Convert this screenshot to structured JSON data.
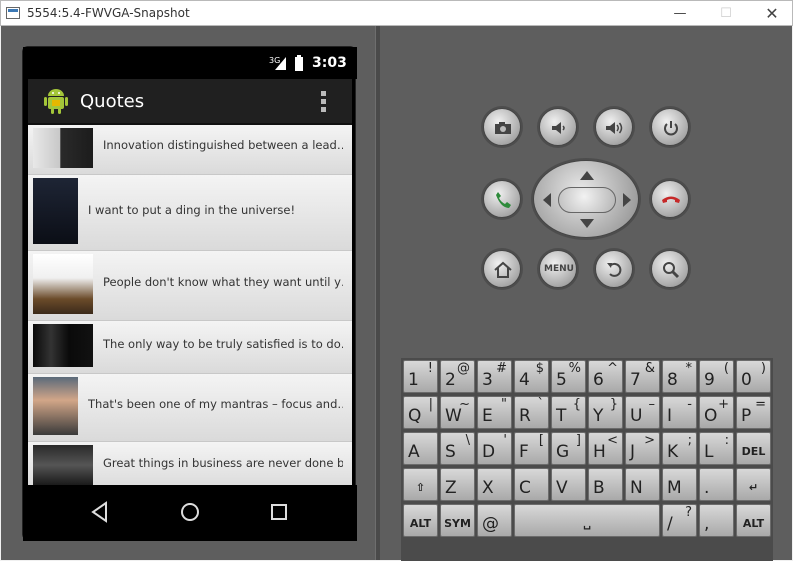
{
  "window": {
    "title": "5554:5.4-FWVGA-Snapshot",
    "minimize_glyph": "—",
    "maximize_glyph": "☐",
    "close_glyph": "✕"
  },
  "phone": {
    "status": {
      "network": "3G",
      "time": "3:03"
    },
    "app": {
      "title": "Quotes",
      "accent": "#a4c639"
    },
    "quotes": [
      "Innovation distinguished between a lead…",
      "I want to put a ding in the universe!",
      "People don't know what they want until y…",
      "The only way to be truly satisfied is to do…",
      "That's been one of my mantras – focus and…",
      "Great things in business are never done b…"
    ]
  },
  "controls": {
    "menu_label": "MENU",
    "icons": [
      "camera-icon",
      "volume-down-icon",
      "volume-up-icon",
      "power-icon",
      "call-icon",
      "end-call-icon",
      "home-icon",
      "menu-button",
      "back-icon",
      "search-icon"
    ]
  },
  "keyboard": {
    "row1": [
      [
        "1",
        "!"
      ],
      [
        "2",
        "@"
      ],
      [
        "3",
        "#"
      ],
      [
        "4",
        "$"
      ],
      [
        "5",
        "%"
      ],
      [
        "6",
        "^"
      ],
      [
        "7",
        "&"
      ],
      [
        "8",
        "*"
      ],
      [
        "9",
        "("
      ],
      [
        "0",
        ")"
      ]
    ],
    "row2": [
      [
        "Q",
        "|"
      ],
      [
        "W",
        "~"
      ],
      [
        "E",
        "\""
      ],
      [
        "R",
        "`"
      ],
      [
        "T",
        "{"
      ],
      [
        "Y",
        "}"
      ],
      [
        "U",
        "–"
      ],
      [
        "I",
        "-"
      ],
      [
        "O",
        "+"
      ],
      [
        "P",
        "="
      ]
    ],
    "row3": [
      [
        "A",
        ""
      ],
      [
        "S",
        "\\"
      ],
      [
        "D",
        "'"
      ],
      [
        "F",
        "["
      ],
      [
        "G",
        "]"
      ],
      [
        "H",
        "<"
      ],
      [
        "J",
        ">"
      ],
      [
        "K",
        ";"
      ],
      [
        "L",
        ":"
      ]
    ],
    "del_label": "DEL",
    "row4": [
      [
        "Z",
        ""
      ],
      [
        "X",
        ""
      ],
      [
        "C",
        ""
      ],
      [
        "V",
        ""
      ],
      [
        "B",
        ""
      ],
      [
        "N",
        ""
      ],
      [
        "M",
        ""
      ],
      [
        ".",
        ""
      ]
    ],
    "alt_label": "ALT",
    "sym_label": "SYM",
    "at_label": "@",
    "slash_label": "/",
    "question_label": "?",
    "comma_label": ","
  }
}
